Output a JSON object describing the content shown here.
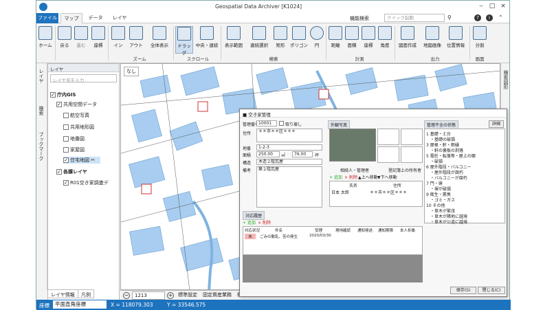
{
  "app": {
    "title": "Geospatial Data Archiver [K1024]"
  },
  "tabs": {
    "file": "ファイル",
    "map": "マップ",
    "data": "データ",
    "layer": "レイヤ"
  },
  "search": {
    "label": "機能検索",
    "placeholder": "クイック起動"
  },
  "ribbon": {
    "home": "ホーム",
    "back": "戻る",
    "forward": "進む",
    "coord": "座標",
    "zoom_in": "イン",
    "zoom_out": "アウト",
    "full": "全体表示",
    "drag": "ドラッグ",
    "center": "中央・連続",
    "display_range": "表示範囲",
    "continuous_select": "連続選択",
    "rect": "矩形",
    "polygon": "ポリゴン",
    "circle": "円",
    "distance": "距離",
    "area": "面積",
    "coordinate": "座標",
    "angle": "角度",
    "print": "図面作成",
    "map_image": "地図画像",
    "position_info": "位置情報",
    "split": "分割",
    "groups": {
      "zoom": "ズーム",
      "scroll": "スクロール",
      "search": "検索",
      "measure": "計測",
      "output": "出力",
      "screen": "画面"
    }
  },
  "left_vtabs": {
    "layer": "レイヤ",
    "search": "検索",
    "bookmark": "ブックマーク"
  },
  "layerpanel": {
    "title": "レイヤ",
    "search_placeholder": "レイヤ名を入力",
    "root": "庁内GIS",
    "items": [
      "共用空間データ",
      "航空写真",
      "共用地形図",
      "地番図",
      "家屋図",
      "住宅地図",
      "各課レイヤ",
      "R01空き家調査デ"
    ]
  },
  "layer_tabs": {
    "info": "レイヤ情報",
    "legend": "凡例"
  },
  "map": {
    "none_label": "なし"
  },
  "map_bottom": {
    "scale": "1213",
    "tab1": "標準設定",
    "tab2": "固定資産業務",
    "tab3": "検索管理",
    "tab4": "災"
  },
  "status": {
    "coord_label": "座標",
    "system": "平面直角座標",
    "x": "X = 118079.303",
    "y": "Y = 33546.575"
  },
  "right_vtab": "検索図形",
  "dialog": {
    "title": "■ 空き家管理",
    "id_label": "管理番号",
    "id_value": "10001",
    "cb_label": "取り壊し",
    "addr_label": "住所",
    "addr_value": "＊＊市＊＊区＊＊＊",
    "lot_label": "地番",
    "lot_value": "1-2-3",
    "area_label": "面積",
    "area_value": "250.00",
    "area_unit": "㎡",
    "area2": "76.00",
    "area2_unit": "坪",
    "struct_label": "構造",
    "struct_value": "木造２階瓦屋",
    "memo_label": "備考",
    "memo_value": "築２階瓦屋",
    "photo_title": "外観写真",
    "tab_owner": "相続人・管理者",
    "tab_reg": "登記簿上の所有者",
    "add": "追加",
    "del": "削除",
    "up": "上へ移動",
    "down": "下へ移動",
    "owner_cols": [
      "氏名",
      "住所"
    ],
    "owner_row": [
      "日本 太郎",
      "＊＊市＊＊区＊＊＊"
    ],
    "status_title": "管理不全の状態",
    "detail_btn": "詳細",
    "status_items": [
      "1 基礎・土台",
      "・基礎の破損",
      "3 屋根・軒・雨樋",
      "・軒の裏板の剥落",
      "5 電柱・転落等・屋上の棚",
      "・破損",
      "6 屋外階段・バルコニー",
      "・屋外階段が腐朽",
      "・バルコニーが腐朽",
      "7 門・塀",
      "・塀が破損",
      "9 衛生・悪臭",
      "・ゴミ・ガス",
      "10 その他",
      "・草木が繁茂",
      "・草木が隣地に越境",
      "・草木が公道に越境"
    ],
    "history_title": "対応履歴",
    "h_add": "追加",
    "h_del": "削除",
    "h_cols": [
      "対応状況",
      "件名",
      "受理",
      "現地確認",
      "通知発送",
      "通知期限",
      "本人折衝"
    ],
    "h_row": [
      "未",
      "ごみの散乱、苦の発生",
      "2020/03/30",
      "",
      "",
      "",
      ""
    ],
    "save": "保存(S)",
    "close": "閉じる(C)"
  },
  "colors": {
    "accent": "#1e73be",
    "road": "#7fb3e0",
    "building": "#a8cdf0"
  }
}
